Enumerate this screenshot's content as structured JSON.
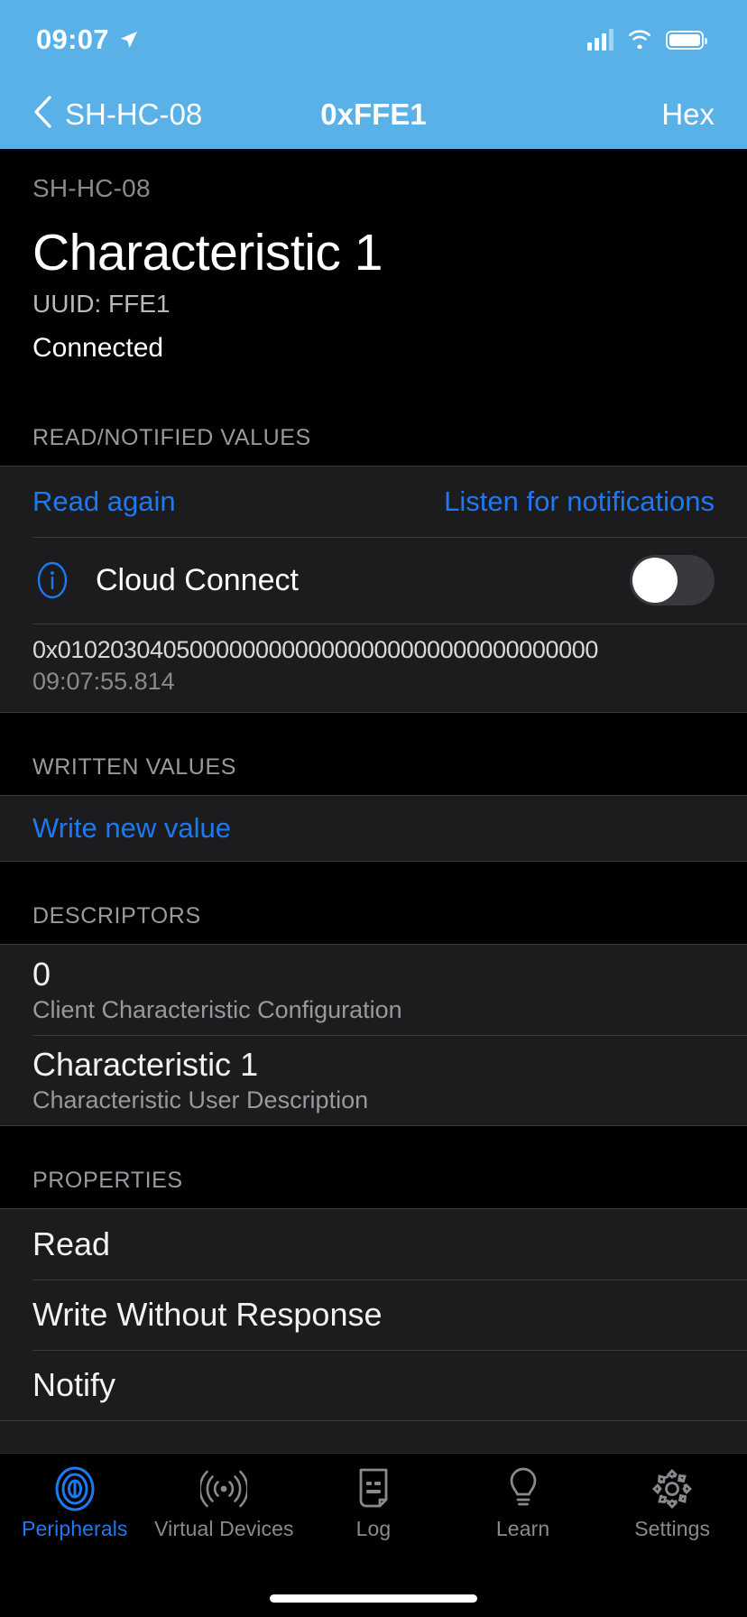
{
  "status_bar": {
    "time": "09:07",
    "location_icon": "location-arrow-icon",
    "cellular_icon": "cellular-signal-icon",
    "wifi_icon": "wifi-icon",
    "battery_icon": "battery-icon"
  },
  "nav": {
    "back_label": "SH-HC-08",
    "back_icon": "chevron-left-icon",
    "title": "0xFFE1",
    "right_label": "Hex"
  },
  "header": {
    "device_name": "SH-HC-08",
    "characteristic_name": "Characteristic 1",
    "uuid": "UUID: FFE1",
    "connection_status": "Connected"
  },
  "read_section": {
    "title": "READ/NOTIFIED VALUES",
    "read_again_label": "Read again",
    "listen_label": "Listen for notifications",
    "cloud_connect": {
      "info_icon": "info-circle-icon",
      "label": "Cloud Connect",
      "toggle_on": false
    },
    "value": {
      "hex": "0x01020304050000000000000000000000000000000",
      "timestamp": "09:07:55.814"
    }
  },
  "written_section": {
    "title": "WRITTEN VALUES",
    "write_label": "Write new value"
  },
  "descriptors_section": {
    "title": "DESCRIPTORS",
    "items": [
      {
        "value": "0",
        "name": "Client Characteristic Configuration"
      },
      {
        "value": "Characteristic 1",
        "name": "Characteristic User Description"
      }
    ]
  },
  "properties_section": {
    "title": "PROPERTIES",
    "items": [
      {
        "label": "Read"
      },
      {
        "label": "Write Without Response"
      },
      {
        "label": "Notify"
      }
    ]
  },
  "tab_bar": {
    "items": [
      {
        "label": "Peripherals",
        "icon": "peripherals-icon",
        "active": true
      },
      {
        "label": "Virtual Devices",
        "icon": "broadcast-icon",
        "active": false
      },
      {
        "label": "Log",
        "icon": "document-icon",
        "active": false
      },
      {
        "label": "Learn",
        "icon": "lightbulb-icon",
        "active": false
      },
      {
        "label": "Settings",
        "icon": "gear-icon",
        "active": false
      }
    ]
  },
  "colors": {
    "nav_blue": "#5AB1E8",
    "accent_blue": "#1E79F0",
    "background": "#000000",
    "row_background": "#1C1C1E",
    "separator": "#3A3A3C"
  }
}
